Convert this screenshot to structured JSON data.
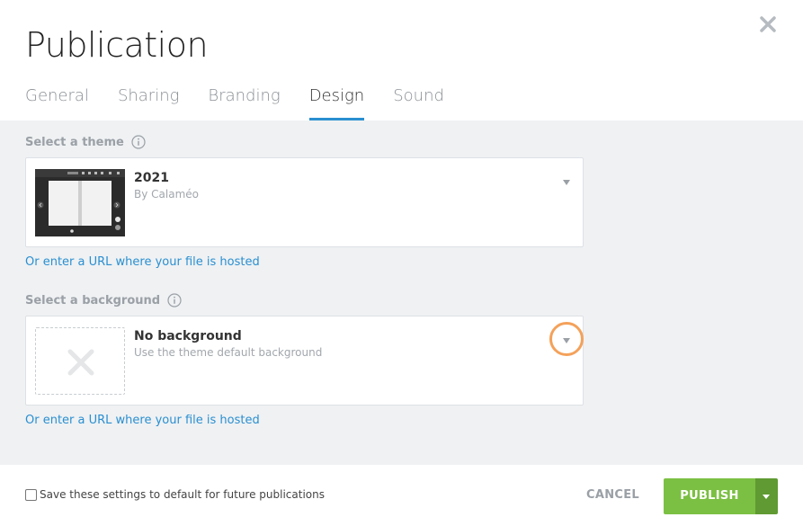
{
  "dialog": {
    "title": "Publication",
    "close_icon": "close-icon"
  },
  "tabs": [
    {
      "label": "General",
      "active": false
    },
    {
      "label": "Sharing",
      "active": false
    },
    {
      "label": "Branding",
      "active": false
    },
    {
      "label": "Design",
      "active": true
    },
    {
      "label": "Sound",
      "active": false
    }
  ],
  "theme": {
    "section_label": "Select a theme",
    "selected_title": "2021",
    "selected_subtitle": "By Calaméo",
    "url_link": "Or enter a URL where your file is hosted"
  },
  "background": {
    "section_label": "Select a background",
    "selected_title": "No background",
    "selected_subtitle": "Use the theme default background",
    "url_link": "Or enter a URL where your file is hosted"
  },
  "footer": {
    "checkbox_label": "Save these settings to default for future publications",
    "checkbox_checked": false,
    "cancel_label": "CANCEL",
    "publish_label": "PUBLISH"
  },
  "colors": {
    "accent": "#2a8fd0",
    "publish": "#7bc043",
    "highlight": "#f4a15a"
  }
}
